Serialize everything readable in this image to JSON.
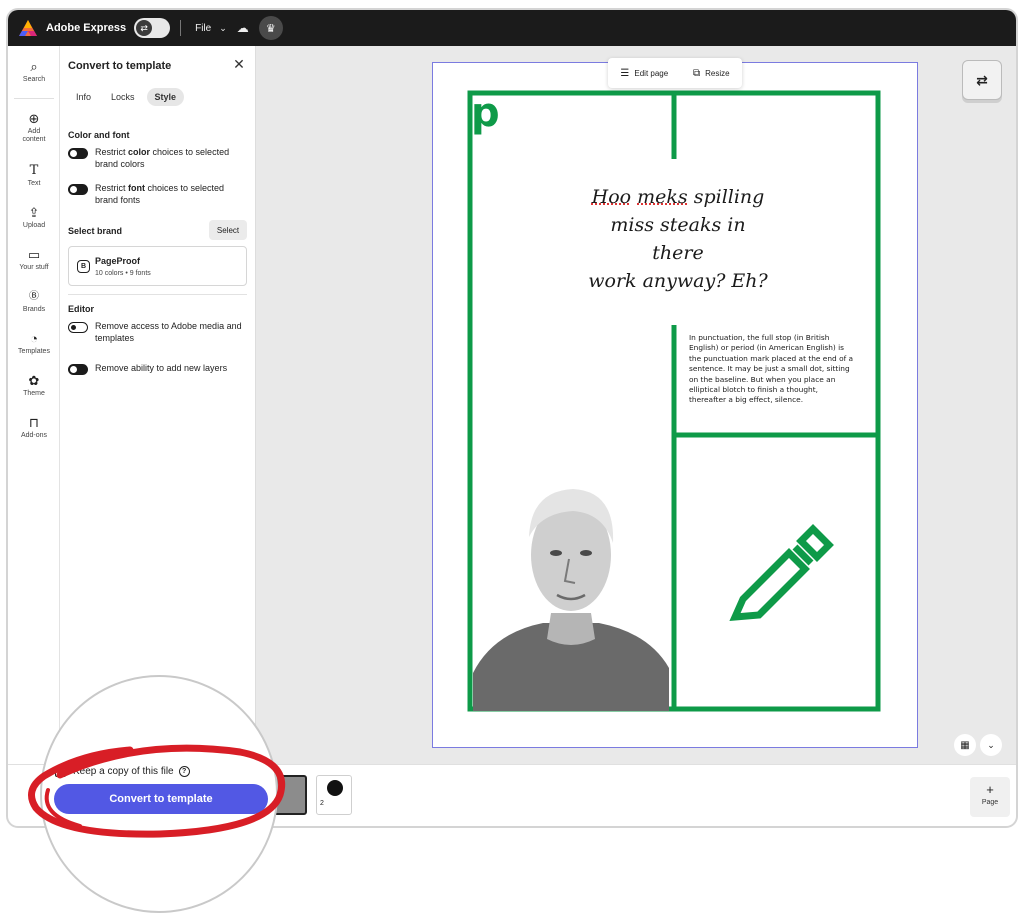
{
  "topbar": {
    "app_name": "Adobe Express",
    "file_label": "File",
    "icons": {
      "logo": "adobe-express-logo",
      "cloud": "cloud-icon",
      "mode": "crown-icon",
      "toggle": "toggle-icon"
    }
  },
  "rail": {
    "items": [
      {
        "label": "Search",
        "icon": "search-icon"
      },
      {
        "label": "Add content",
        "icon": "plus-circle-icon"
      },
      {
        "label": "Text",
        "icon": "text-icon"
      },
      {
        "label": "Upload",
        "icon": "upload-icon"
      },
      {
        "label": "Your stuff",
        "icon": "folder-icon"
      },
      {
        "label": "Brands",
        "icon": "brand-icon"
      },
      {
        "label": "Templates",
        "icon": "templates-icon"
      },
      {
        "label": "Theme",
        "icon": "palette-icon"
      },
      {
        "label": "Add-ons",
        "icon": "addons-icon"
      }
    ]
  },
  "panel": {
    "title": "Convert to template",
    "tabs": [
      {
        "label": "Info",
        "active": false
      },
      {
        "label": "Locks",
        "active": false
      },
      {
        "label": "Style",
        "active": true
      }
    ],
    "color_font": {
      "heading": "Color and font",
      "restrict_color_pre": "Restrict ",
      "restrict_color_bold": "color",
      "restrict_color_post": " choices to selected brand colors",
      "restrict_font_pre": "Restrict ",
      "restrict_font_bold": "font",
      "restrict_font_post": " choices to selected brand fonts"
    },
    "brand": {
      "heading": "Select brand",
      "select_label": "Select",
      "name": "PageProof",
      "meta": "10 colors • 9 fonts",
      "icon_letter": "B"
    },
    "editor": {
      "heading": "Editor",
      "remove_access": "Remove access to Adobe media and templates",
      "remove_layers": "Remove ability to add new layers"
    }
  },
  "canvas": {
    "toolbar": {
      "edit_page": "Edit page",
      "resize": "Resize"
    },
    "design": {
      "headline_word1": "Hoo",
      "headline_word2": "meks",
      "headline_rest1": " spilling",
      "headline_line2": "miss steaks in there",
      "headline_line3": "work anyway? Eh?",
      "body": "In punctuation, the full stop (in British English) or period (in American English) is the punctuation mark placed at the end of a sentence. It may be just a small dot, sitting on the baseline. But when you place an elliptical blotch to finish a thought, thereafter a big effect, silence.",
      "accent_color": "#0e9a48",
      "logo_letter": "p"
    }
  },
  "bottombar": {
    "page_number": "2",
    "add_page_plus": "+",
    "add_page_label": "Page"
  },
  "footer": {
    "keep_copy": "Keep a copy of this file",
    "help_glyph": "?",
    "convert_button": "Convert to template",
    "button_color": "#5258e4",
    "highlight_color": "#d81e26"
  }
}
